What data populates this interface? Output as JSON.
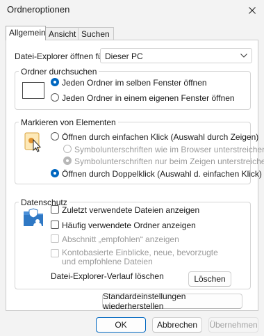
{
  "window": {
    "title": "Ordneroptionen"
  },
  "tabs": [
    {
      "label": "Allgemein"
    },
    {
      "label": "Ansicht"
    },
    {
      "label": "Suchen"
    }
  ],
  "explorer_open": {
    "label": "Datei-Explorer öffnen für:",
    "value": "Dieser PC"
  },
  "browse_folders": {
    "label": "Ordner durchsuchen",
    "options": [
      {
        "label": "Jeden Ordner im selben Fenster öffnen",
        "selected": true
      },
      {
        "label": "Jeden Ordner in einem eigenen Fenster öffnen",
        "selected": false
      }
    ]
  },
  "click_items": {
    "label": "Markieren von Elementen",
    "single_click": "Öffnen durch einfachen Klick (Auswahl durch Zeigen)",
    "underline_browser": "Symbolunterschriften wie im Browser unterstreichen",
    "underline_pointing": "Symbolunterschriften nur beim Zeigen unterstreichen",
    "double_click": "Öffnen durch Doppelklick (Auswahl d. einfachen Klick)"
  },
  "privacy": {
    "label": "Datenschutz",
    "recent_files": "Zuletzt verwendete Dateien anzeigen",
    "frequent_folders": "Häufig verwendete Ordner anzeigen",
    "recommended_section": "Abschnitt „empfohlen“ anzeigen",
    "account_insights": "Kontobasierte Einblicke, neue, bevorzugte und empfohlene Dateien",
    "clear_history_label": "Datei-Explorer-Verlauf löschen",
    "clear_button": "Löschen"
  },
  "restore_defaults": "Standardeinstellungen wiederherstellen",
  "footer": {
    "ok": "OK",
    "cancel": "Abbrechen",
    "apply": "Übernehmen"
  },
  "colors": {
    "accent": "#0067c0",
    "background": "#f3f3f3",
    "panel": "#ffffff"
  }
}
